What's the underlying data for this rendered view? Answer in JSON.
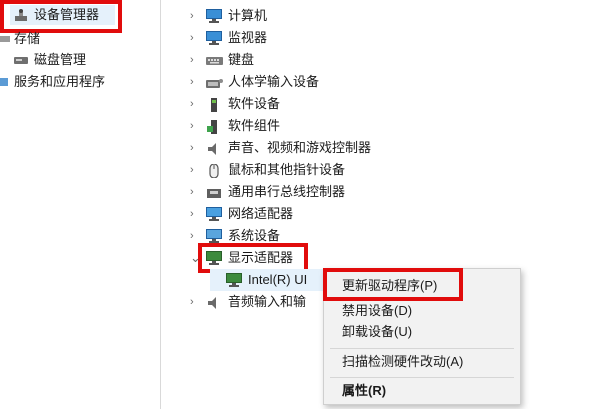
{
  "left_tree": {
    "device_manager": "设备管理器",
    "storage": "存储",
    "disk_management": "磁盘管理",
    "services_apps": "服务和应用程序"
  },
  "device_tree": [
    {
      "label": "计算机",
      "icon": "computer-icon",
      "chevron": "›"
    },
    {
      "label": "监视器",
      "icon": "monitor-icon",
      "chevron": "›"
    },
    {
      "label": "键盘",
      "icon": "keyboard-icon",
      "chevron": "›"
    },
    {
      "label": "人体学输入设备",
      "icon": "hid-icon",
      "chevron": "›"
    },
    {
      "label": "软件设备",
      "icon": "software-device-icon",
      "chevron": "›"
    },
    {
      "label": "软件组件",
      "icon": "software-component-icon",
      "chevron": "›"
    },
    {
      "label": "声音、视频和游戏控制器",
      "icon": "speaker-icon",
      "chevron": "›"
    },
    {
      "label": "鼠标和其他指针设备",
      "icon": "mouse-icon",
      "chevron": "›"
    },
    {
      "label": "通用串行总线控制器",
      "icon": "usb-icon",
      "chevron": "›"
    },
    {
      "label": "网络适配器",
      "icon": "network-adapter-icon",
      "chevron": "›"
    },
    {
      "label": "系统设备",
      "icon": "system-device-icon",
      "chevron": "›"
    },
    {
      "label": "显示适配器",
      "icon": "display-adapter-icon",
      "chevron": "⌄"
    },
    {
      "label": "Intel(R) UI",
      "icon": "display-adapter-icon",
      "chevron": ""
    },
    {
      "label": "音频输入和输",
      "icon": "speaker-icon",
      "chevron": "›"
    }
  ],
  "context_menu": {
    "update_driver": "更新驱动程序(P)",
    "disable": "禁用设备(D)",
    "uninstall": "卸载设备(U)",
    "scan": "扫描检测硬件改动(A)",
    "properties": "属性(R)"
  },
  "colors": {
    "highlight": "#e10c0c",
    "accent": "#3a8fd6"
  }
}
